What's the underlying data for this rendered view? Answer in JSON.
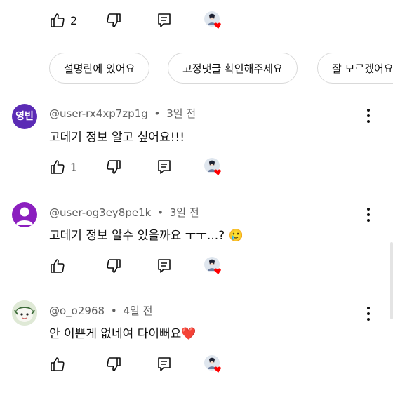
{
  "top_actions": {
    "like_count": "2"
  },
  "chips": [
    "설명란에 있어요",
    "고정댓글 확인해주세요",
    "잘 모르겠어요"
  ],
  "comments": [
    {
      "avatar_text": "영빈",
      "avatar_color": "#5b2bb5",
      "author": "@user-rx4xp7zp1g",
      "time": "3일 전",
      "text": "고데기 정보 알고 싶어요!!!",
      "like_count": "1"
    },
    {
      "avatar_color": "#8b1fbf",
      "author": "@user-og3ey8pe1k",
      "time": "3일 전",
      "text": "고데기 정보 알수 있을까요 ㅜㅜ...? 🥲",
      "like_count": ""
    },
    {
      "author": "@o_o2968",
      "time": "4일 전",
      "text": "안 이쁜게 없네여 다이뻐요❤️",
      "like_count": ""
    }
  ],
  "separator": "•",
  "icons": {
    "like": "thumbs-up-icon",
    "dislike": "thumbs-down-icon",
    "reply": "reply-comment-icon",
    "creator_heart": "creator-heart-icon",
    "more": "more-vert-icon"
  },
  "colors": {
    "heart": "#ff0000",
    "meta": "#606060",
    "chip_border": "#d9d9d9"
  }
}
